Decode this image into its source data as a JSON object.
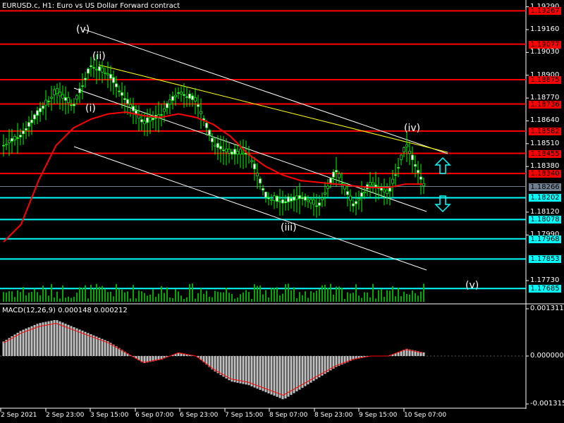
{
  "header": {
    "title": "EURUSD.c, H1:  Euro vs US Dollar Forward contract"
  },
  "macd": {
    "label": "MACD(12,26,9) 0.000148 0.000212",
    "axis": [
      "0.001311",
      "0.000000",
      "-0.001315"
    ]
  },
  "price_axis": [
    "1.19290",
    "1.19160",
    "1.19030",
    "1.18900",
    "1.18770",
    "1.18640",
    "1.18510",
    "1.18380",
    "1.18120",
    "1.17990",
    "1.17730"
  ],
  "levels": {
    "red": [
      "1.19267",
      "1.19077",
      "1.18875",
      "1.18736",
      "1.18582",
      "1.18455",
      "1.18340"
    ],
    "cyan": [
      "1.18202",
      "1.18078",
      "1.17968",
      "1.17853",
      "1.17685"
    ],
    "current": "1.18266"
  },
  "time_axis": [
    "2 Sep 2021",
    "2 Sep 23:00",
    "3 Sep 15:00",
    "6 Sep 07:00",
    "6 Sep 23:00",
    "7 Sep 15:00",
    "8 Sep 07:00",
    "8 Sep 23:00",
    "9 Sep 15:00",
    "10 Sep 07:00"
  ],
  "waves": [
    "(v)",
    "(ii)",
    "(i)",
    "(iii)",
    "(iv)",
    "(v)"
  ],
  "colors": {
    "red": "#ff0000",
    "cyan": "#00ffff",
    "candle": "#00ff00",
    "current": "#708090",
    "ma": "#ff0000"
  },
  "chart_data": {
    "type": "line",
    "series": [
      {
        "name": "close",
        "values": [
          1.185,
          1.1855,
          1.1868,
          1.188,
          1.1872,
          1.1895,
          1.189,
          1.1875,
          1.1862,
          1.1867,
          1.188,
          1.1875,
          1.185,
          1.1845,
          1.1845,
          1.182,
          1.1817,
          1.182,
          1.1815,
          1.1835,
          1.1815,
          1.1828,
          1.1822,
          1.185,
          1.1827
        ]
      },
      {
        "name": "ma",
        "values": [
          1.1795,
          1.1805,
          1.183,
          1.185,
          1.186,
          1.1865,
          1.1868,
          1.1869,
          1.1867,
          1.1866,
          1.1868,
          1.1866,
          1.1862,
          1.1855,
          1.1845,
          1.1838,
          1.1833,
          1.183,
          1.1829,
          1.1828,
          1.1827,
          1.1826,
          1.1826,
          1.1828,
          1.1828
        ]
      },
      {
        "name": "macd_hist",
        "values": [
          0.0004,
          0.0007,
          0.0009,
          0.001,
          0.0008,
          0.0006,
          0.0004,
          0.0001,
          -0.0002,
          -0.0001,
          0.0001,
          0.0,
          -0.0004,
          -0.0007,
          -0.0008,
          -0.001,
          -0.0012,
          -0.0009,
          -0.0006,
          -0.0003,
          -0.0001,
          0.0,
          0.0,
          0.0002,
          0.0001
        ]
      }
    ],
    "ylim": [
      1.176,
      1.193
    ]
  }
}
